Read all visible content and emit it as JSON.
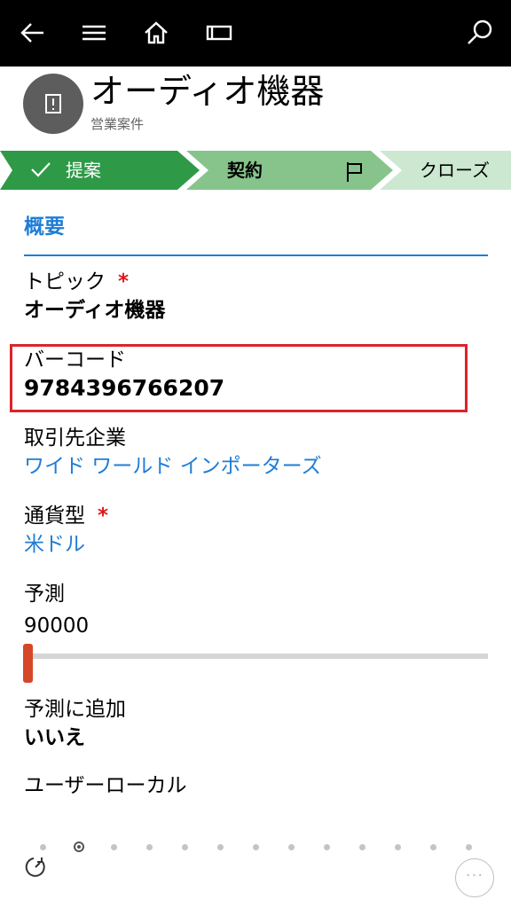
{
  "toolbar": {
    "back_icon": "back-arrow-icon",
    "menu_icon": "hamburger-menu-icon",
    "home_icon": "home-icon",
    "view_icon": "tablet-view-icon",
    "search_icon": "search-icon"
  },
  "header": {
    "title": "オーディオ機器",
    "subtitle": "営業案件",
    "avatar_icon": "opportunity-icon"
  },
  "process": {
    "stages": [
      {
        "label": "提案",
        "state": "completed",
        "color": "#2e9a47"
      },
      {
        "label": "契約",
        "state": "active",
        "color": "#86c48b"
      },
      {
        "label": "クローズ",
        "state": "pending",
        "color": "#cde8d1"
      }
    ]
  },
  "section": {
    "title": "概要"
  },
  "fields": {
    "topic": {
      "label": "トピック",
      "required": "*",
      "value": "オーディオ機器"
    },
    "barcode": {
      "label": "バーコード",
      "value": "9784396766207"
    },
    "account": {
      "label": "取引先企業",
      "value": "ワイド ワールド インポーターズ"
    },
    "currency": {
      "label": "通貨型",
      "required": "*",
      "value": "米ドル"
    },
    "forecast": {
      "label": "予測",
      "value": "90000",
      "slider_fraction": 0
    },
    "forecast_add": {
      "label": "予測に追加",
      "value": "いいえ"
    },
    "user_local": {
      "label": "ユーザーローカル"
    }
  },
  "pager": {
    "count": 13,
    "active_index": 1
  },
  "footer": {
    "more_label": "···"
  },
  "colors": {
    "accent": "#1f7dd6",
    "required": "#e0181c",
    "highlight": "#d9252b",
    "slider": "#d64727"
  }
}
